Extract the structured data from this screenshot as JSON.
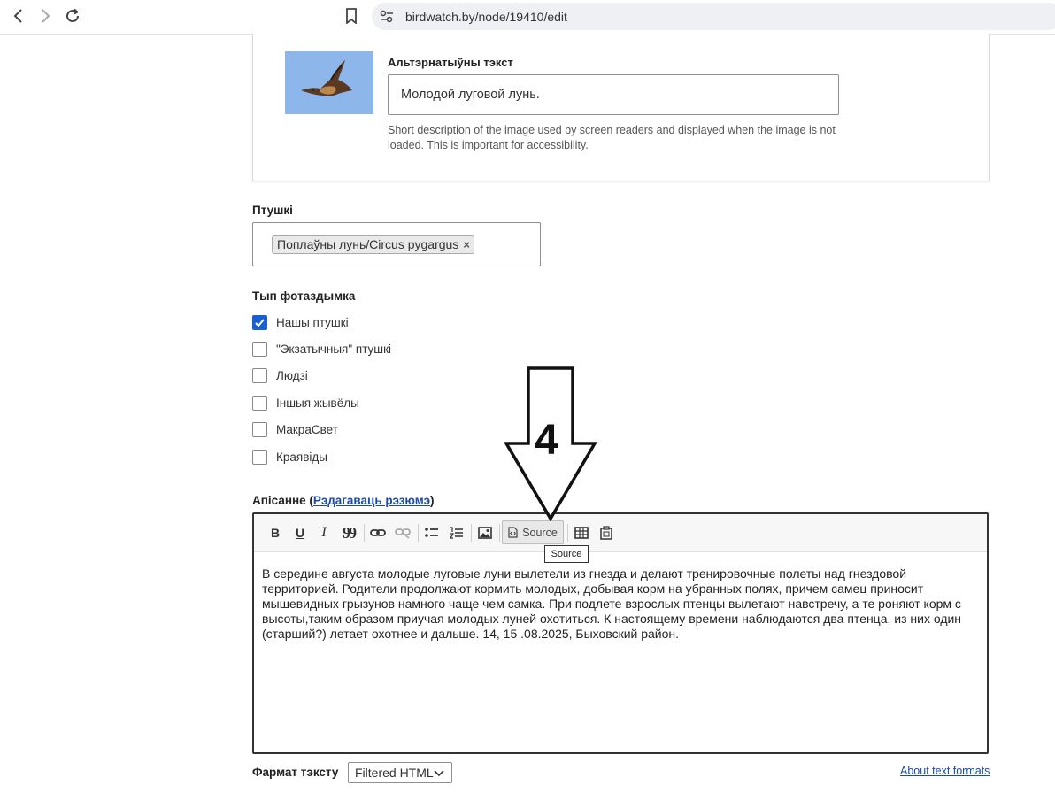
{
  "browser": {
    "url": "birdwatch.by/node/19410/edit"
  },
  "media": {
    "alt_label": "Альтэрнатыўны тэкст",
    "alt_value": "Молодой луговой лунь.",
    "alt_description": "Short description of the image used by screen readers and displayed when the image is not loaded. This is important for accessibility."
  },
  "birds": {
    "label": "Птушкі",
    "tags": [
      {
        "text": "Поплаўны лунь/Circus pygargus",
        "remove": "×"
      }
    ]
  },
  "photo_type": {
    "label": "Тып фотаздымка",
    "options": [
      {
        "label": "Нашы птушкі",
        "checked": true
      },
      {
        "label": "\"Экзатычныя\" птушкі",
        "checked": false
      },
      {
        "label": "Людзі",
        "checked": false
      },
      {
        "label": "Іншыя жывёлы",
        "checked": false
      },
      {
        "label": "МакраСвет",
        "checked": false
      },
      {
        "label": "Краявіды",
        "checked": false
      }
    ]
  },
  "description": {
    "label": "Апісанне (",
    "link": "Рэдагаваць рэзюмэ",
    "label_end": ")",
    "toolbar": {
      "bold": "B",
      "underline": "U",
      "italic": "I",
      "quote": "99",
      "source": "Source"
    },
    "tooltip": "Source",
    "text": "В середине августа молодые луговые луни вылетели из гнезда и делают тренировочные полеты над гнездовой территорией. Родители продолжают кормить молодых, добывая корм на убранных полях, причем самец приносит мышевидных грызунов намного чаще чем самка. При подлете взрослых птенцы вылетают навстречу, а те роняют корм с высоты,таким образом приучая молодых луней охотиться. К настоящему времени наблюдаются два птенца, из них один (старший?) летает охотнее и дальше. 14, 15 .08.2025, Быховский район."
  },
  "format": {
    "label": "Фармат тэксту",
    "selected": "Filtered HTML",
    "about_link": "About text formats"
  },
  "annotation": {
    "number": "4"
  }
}
